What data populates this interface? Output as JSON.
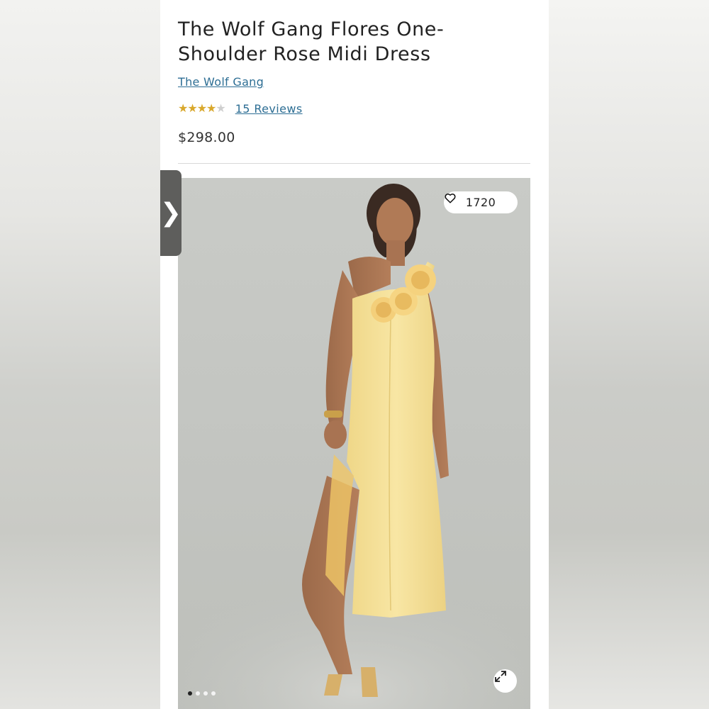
{
  "product": {
    "title": "The Wolf Gang Flores One-Shoulder Rose Midi Dress",
    "brand": "The Wolf Gang",
    "rating": {
      "value": 4,
      "max": 5,
      "reviews_label": "15 Reviews"
    },
    "price": "$298.00"
  },
  "gallery": {
    "likes": "1720",
    "dots_total": 4,
    "active_dot": 1
  },
  "icons": {
    "heart": "heart-outline-icon",
    "expand": "expand-arrows-icon",
    "tab": "chevron-right-icon"
  },
  "side_tab": {
    "glyph": "❯"
  },
  "colors": {
    "link": "#2d6e94",
    "star": "#d9a82c",
    "dress": "#f6e29b"
  }
}
